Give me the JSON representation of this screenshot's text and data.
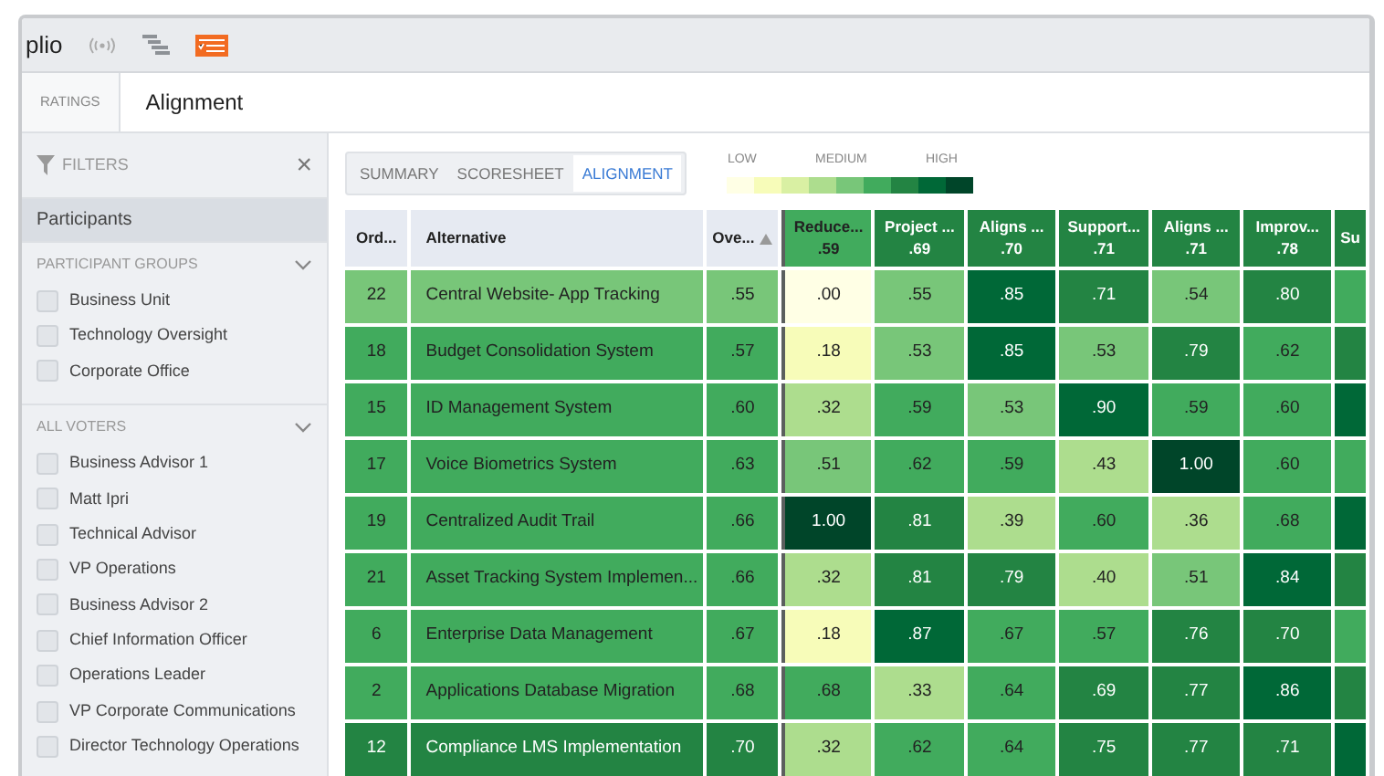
{
  "app_title": "plio",
  "breadcrumb": {
    "parent": "RATINGS",
    "current": "Alignment"
  },
  "filters": {
    "title": "FILTERS",
    "close": "×"
  },
  "participants": {
    "label": "Participants",
    "selected": true
  },
  "groups": [
    {
      "title": "PARTICIPANT GROUPS",
      "expanded": true,
      "items": [
        {
          "label": "Business Unit",
          "checked": false
        },
        {
          "label": "Technology Oversight",
          "checked": false
        },
        {
          "label": "Corporate Office",
          "checked": false
        }
      ]
    },
    {
      "title": "ALL VOTERS",
      "expanded": true,
      "items": [
        {
          "label": "Business Advisor 1",
          "checked": false
        },
        {
          "label": "Matt Ipri",
          "checked": false
        },
        {
          "label": "Technical Advisor",
          "checked": false
        },
        {
          "label": "VP Operations",
          "checked": false
        },
        {
          "label": "Business Advisor 2",
          "checked": false
        },
        {
          "label": "Chief Information Officer",
          "checked": false
        },
        {
          "label": "Operations Leader",
          "checked": false
        },
        {
          "label": "VP Corporate Communications",
          "checked": false
        },
        {
          "label": "Director Technology Operations",
          "checked": false
        }
      ]
    }
  ],
  "tabs": [
    {
      "label": "SUMMARY",
      "selected": false
    },
    {
      "label": "SCORESHEET",
      "selected": false
    },
    {
      "label": "ALIGNMENT",
      "selected": true
    }
  ],
  "legend": {
    "low": "LOW",
    "medium": "MEDIUM",
    "high": "HIGH"
  },
  "table": {
    "fixed_columns": [
      "Ord...",
      "Alternative",
      "Ove..."
    ],
    "score_columns": [
      {
        "label": "Reduce...",
        "value": ".59"
      },
      {
        "label": "Project ...",
        "value": ".69"
      },
      {
        "label": "Aligns ...",
        "value": ".70"
      },
      {
        "label": "Support...",
        "value": ".71"
      },
      {
        "label": "Aligns ...",
        "value": ".71"
      },
      {
        "label": "Improv...",
        "value": ".78"
      },
      {
        "label": "Su"
      }
    ],
    "rows": [
      {
        "order": "22",
        "alternative": "Central Website- App Tracking",
        "overall": ".55",
        "scores": [
          ".00",
          ".55",
          ".85",
          ".71",
          ".54",
          ".80"
        ],
        "color": "#41ab5d"
      },
      {
        "order": "18",
        "alternative": "Budget Consolidation System",
        "overall": ".57",
        "scores": [
          ".18",
          ".53",
          ".85",
          ".53",
          ".79",
          ".62"
        ],
        "color": "#238443"
      },
      {
        "order": "15",
        "alternative": "ID Management System",
        "overall": ".60",
        "scores": [
          ".32",
          ".59",
          ".53",
          ".90",
          ".59",
          ".60"
        ],
        "color": "#006837"
      },
      {
        "order": "17",
        "alternative": "Voice Biometrics System",
        "overall": ".63",
        "scores": [
          ".51",
          ".62",
          ".59",
          ".43",
          "1.00",
          ".60"
        ],
        "color": "#41ab5d"
      },
      {
        "order": "19",
        "alternative": "Centralized Audit Trail",
        "overall": ".66",
        "scores": [
          "1.00",
          ".81",
          ".39",
          ".60",
          ".36",
          ".68"
        ],
        "color": "#006837"
      },
      {
        "order": "21",
        "alternative": "Asset Tracking System Implemen...",
        "overall": ".66",
        "scores": [
          ".32",
          ".81",
          ".79",
          ".40",
          ".51",
          ".84"
        ],
        "color": "#238443"
      },
      {
        "order": "6",
        "alternative": "Enterprise Data Management",
        "overall": ".67",
        "scores": [
          ".18",
          ".87",
          ".67",
          ".57",
          ".76",
          ".70"
        ],
        "color": "#41ab5d"
      },
      {
        "order": "2",
        "alternative": "Applications Database Migration",
        "overall": ".68",
        "scores": [
          ".68",
          ".33",
          ".64",
          ".69",
          ".77",
          ".86"
        ],
        "color": "#238443"
      },
      {
        "order": "12",
        "alternative": "Compliance LMS Implementation",
        "overall": ".70",
        "scores": [
          ".32",
          ".62",
          ".64",
          ".75",
          ".77",
          ".71"
        ],
        "color": "#006837"
      }
    ]
  }
}
